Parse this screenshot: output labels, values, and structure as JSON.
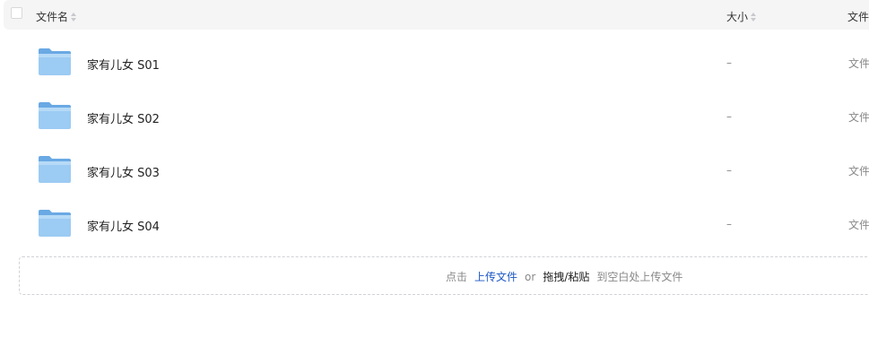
{
  "header": {
    "name_label": "文件名",
    "size_label": "大小",
    "type_label": "文件"
  },
  "rows": [
    {
      "name": "家有儿女 S01",
      "size": "–",
      "type": "文件"
    },
    {
      "name": "家有儿女 S02",
      "size": "–",
      "type": "文件"
    },
    {
      "name": "家有儿女 S03",
      "size": "–",
      "type": "文件"
    },
    {
      "name": "家有儿女 S04",
      "size": "–",
      "type": "文件"
    }
  ],
  "upload": {
    "prefix": "点击",
    "upload_link": "上传文件",
    "or": "or",
    "drag_paste": "拖拽/粘贴",
    "suffix": "到空白处上传文件"
  },
  "colors": {
    "folder": "#6fb3ec",
    "link": "#1a56c4",
    "header_bg": "#f5f5f6"
  },
  "icons": {
    "folder": "folder-icon",
    "sort": "sort-icon",
    "checkbox": "checkbox"
  }
}
